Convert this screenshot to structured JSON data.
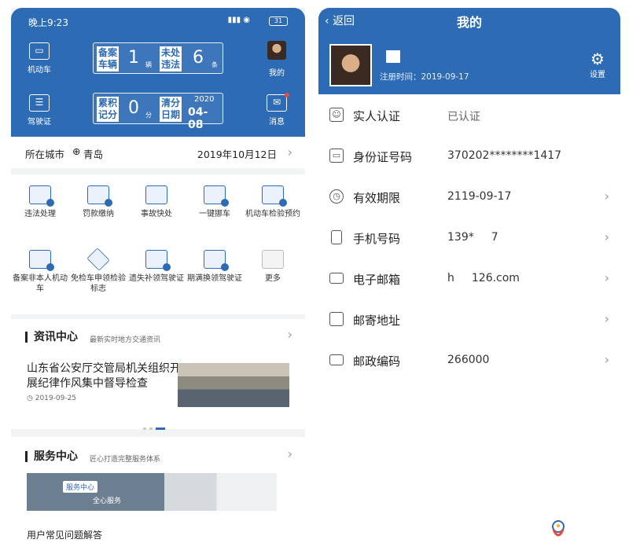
{
  "left": {
    "status": {
      "time": "晚上9:23",
      "signal": "ᯤ",
      "battery": "31"
    },
    "header": {
      "car_label": "机动车",
      "license_label": "驾驶证",
      "mine_label": "我的",
      "message_label": "消息",
      "registered": {
        "label": "备案车辆",
        "value": "1",
        "unit": "辆"
      },
      "violations": {
        "label": "未处违法",
        "value": "6",
        "unit": "条"
      },
      "points": {
        "label": "累积记分",
        "value": "0",
        "unit": "分"
      },
      "clear_date": {
        "label": "清分日期",
        "year": "2020",
        "date": "04-08"
      }
    },
    "city": {
      "label": "所在城市",
      "icon": "⊕",
      "name": "青岛",
      "date": "2019年10月12日"
    },
    "grid": [
      {
        "label": "违法处理"
      },
      {
        "label": "罚款缴纳"
      },
      {
        "label": "事故快处"
      },
      {
        "label": "一键挪车"
      },
      {
        "label": "机动车检验预约"
      },
      {
        "label": "备案非本人机动车"
      },
      {
        "label": "免检车申领检验标志"
      },
      {
        "label": "遗失补领驾驶证"
      },
      {
        "label": "期满换领驾驶证"
      },
      {
        "label": "更多"
      }
    ],
    "news": {
      "title": "资讯中心",
      "subtitle": "最新实时地方交通资讯",
      "headline": "山东省公安厅交管局机关组织开展纪律作风集中督导检查",
      "date": "2019-09-25"
    },
    "service": {
      "title": "服务中心",
      "subtitle": "匠心打造完整服务体系",
      "banner_tag": "服务中心",
      "banner_text": "全心服务",
      "faq": "用户常见问题解答"
    }
  },
  "right": {
    "back_label": "返回",
    "title": "我的",
    "register_text": "注册时间：2019-09-17",
    "settings_label": "设置",
    "rows": [
      {
        "label": "实人认证",
        "value": "已认证",
        "chevron": false
      },
      {
        "label": "身份证号码",
        "value": "370202********1417",
        "chevron": false
      },
      {
        "label": "有效期限",
        "value": "2119-09-17",
        "chevron": true
      },
      {
        "label": "手机号码",
        "value": "139*",
        "value_tail": "7",
        "chevron": true
      },
      {
        "label": "电子邮箱",
        "value": "h",
        "value_tail": "126.com",
        "chevron": true
      },
      {
        "label": "邮寄地址",
        "value": "",
        "chevron": true
      },
      {
        "label": "邮政编码",
        "value": "266000",
        "chevron": true
      }
    ]
  },
  "colors": {
    "brand": "#2d6bb5",
    "text": "#222222",
    "muted": "#666666"
  }
}
